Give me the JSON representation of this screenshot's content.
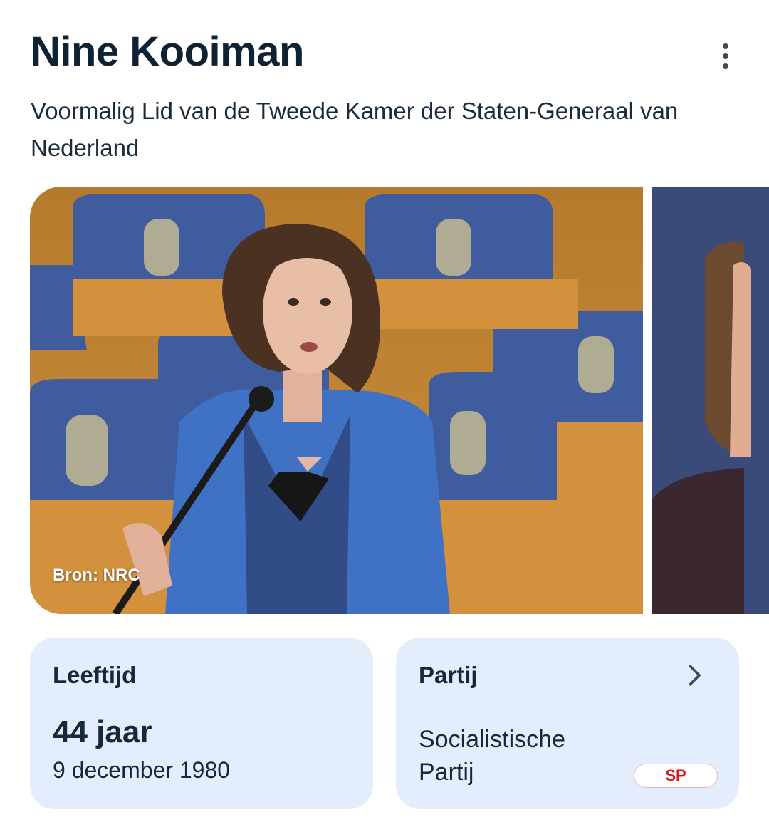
{
  "header": {
    "title": "Nine Kooiman",
    "subtitle": "Voormalig Lid van de Tweede Kamer der Staten-Generaal van Nederland"
  },
  "menu": {
    "icon": "more-vert-icon"
  },
  "gallery": {
    "credit": "Bron: NRC"
  },
  "cards": {
    "age": {
      "label": "Leeftijd",
      "value": "44 jaar",
      "date": "9 december 1980"
    },
    "party": {
      "label": "Partij",
      "name": "Socialistische Partij",
      "logo_text": "SP",
      "icon": "chevron-right-icon"
    }
  },
  "colors": {
    "card_bg": "#e4edfc",
    "text": "#17283a",
    "party_red": "#e1141b"
  }
}
